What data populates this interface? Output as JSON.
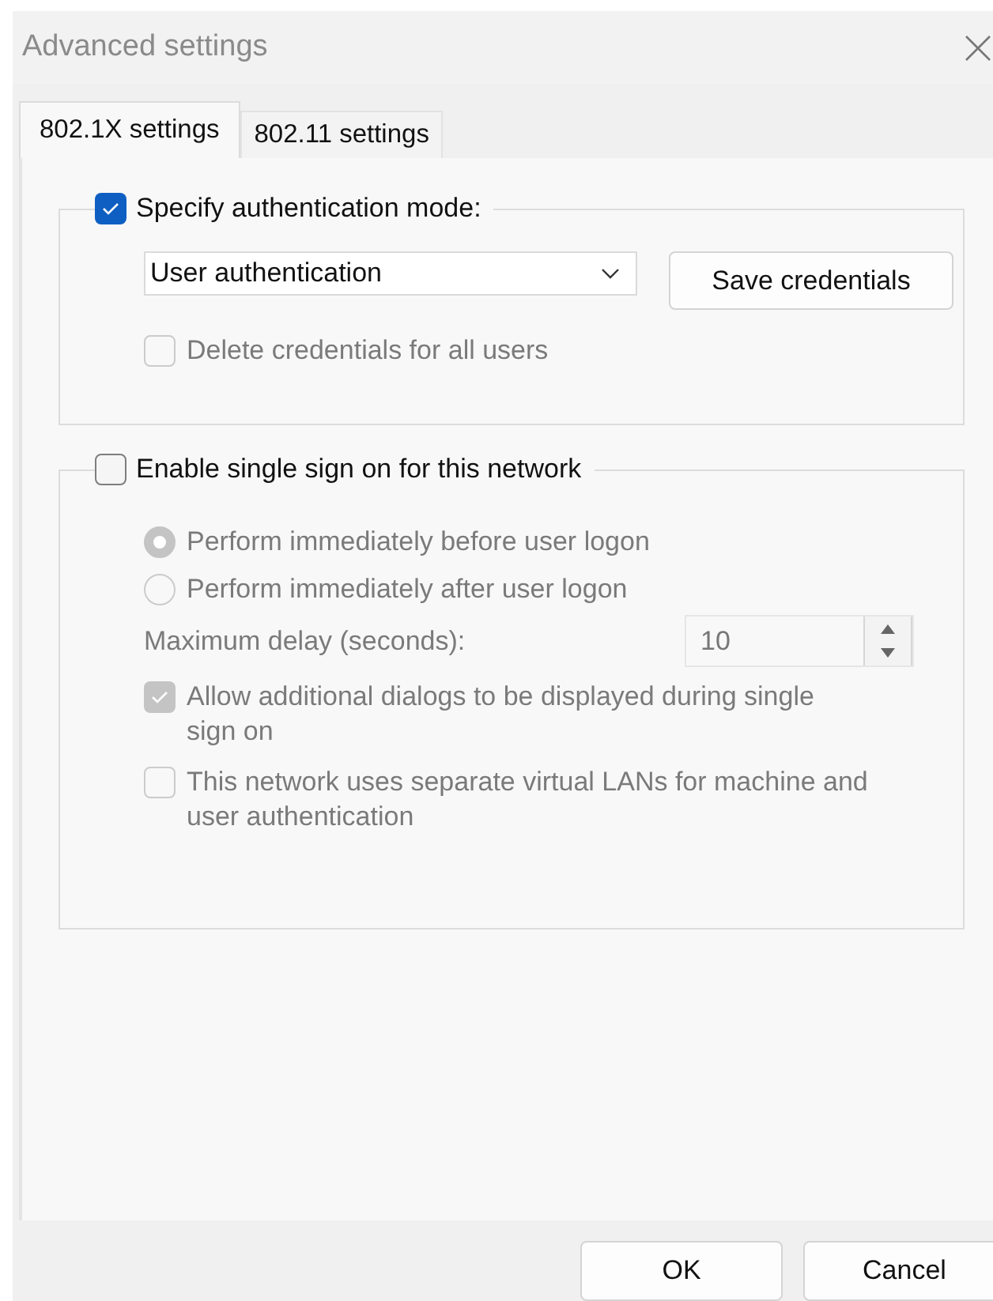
{
  "window": {
    "title": "Advanced settings"
  },
  "tabs": [
    {
      "label": "802.1X settings",
      "selected": true
    },
    {
      "label": "802.11 settings",
      "selected": false
    }
  ],
  "auth_group": {
    "label": "Specify authentication mode:",
    "checked": true,
    "mode": {
      "value": "User authentication"
    },
    "save_button": "Save credentials",
    "delete_option": {
      "label": "Delete credentials for all users",
      "checked": false,
      "disabled": true
    }
  },
  "sso_group": {
    "label": "Enable single sign on for this network",
    "checked": false,
    "options": [
      {
        "kind": "radio",
        "label": "Perform immediately before user logon",
        "selected": true,
        "disabled": true
      },
      {
        "kind": "radio",
        "label": "Perform immediately after user logon",
        "selected": false,
        "disabled": true
      },
      {
        "kind": "spinner",
        "label": "Maximum delay (seconds):",
        "value": "10",
        "disabled": true
      },
      {
        "kind": "checkbox",
        "label": "Allow additional dialogs to be displayed during single sign on",
        "checked": true,
        "disabled": true
      },
      {
        "kind": "checkbox",
        "label": "This network uses separate virtual LANs for machine and user authentication",
        "checked": false,
        "disabled": true
      }
    ]
  },
  "buttons": [
    "OK",
    "Cancel"
  ]
}
